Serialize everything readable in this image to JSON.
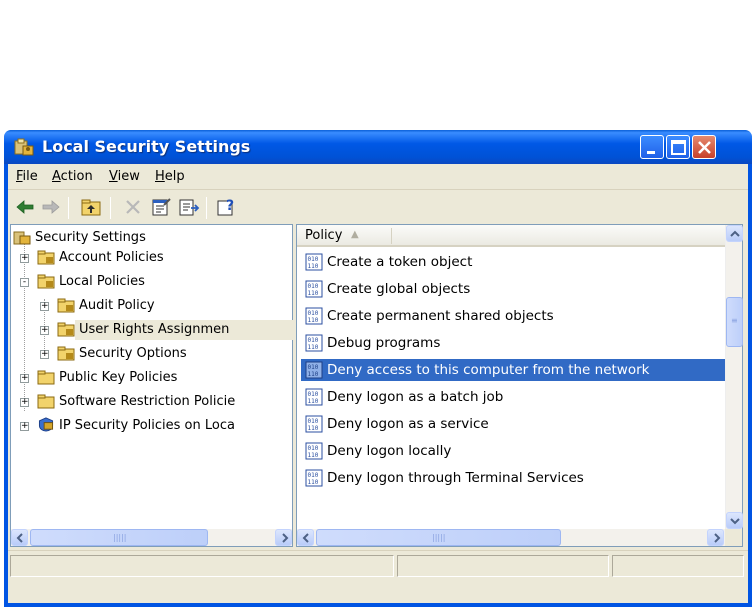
{
  "window": {
    "title": "Local Security Settings",
    "accent": "#0054e3"
  },
  "menu": {
    "items": [
      {
        "label": "File",
        "mnemonic": "F",
        "rest": "ile"
      },
      {
        "label": "Action",
        "mnemonic": "A",
        "rest": "ction"
      },
      {
        "label": "View",
        "mnemonic": "V",
        "rest": "iew"
      },
      {
        "label": "Help",
        "mnemonic": "H",
        "rest": "elp"
      }
    ]
  },
  "toolbar": {
    "icons": [
      "back-arrow-icon",
      "forward-arrow-icon",
      "up-folder-icon",
      "delete-icon",
      "properties-icon",
      "export-list-icon",
      "help-icon"
    ]
  },
  "tree": {
    "root": "Security Settings",
    "items": [
      {
        "label": "Account Policies",
        "level": 1,
        "expander": "+"
      },
      {
        "label": "Local Policies",
        "level": 1,
        "expander": "-"
      },
      {
        "label": "Audit Policy",
        "level": 2,
        "expander": "+"
      },
      {
        "label": "User Rights Assignmen",
        "level": 2,
        "expander": "+",
        "selected": true
      },
      {
        "label": "Security Options",
        "level": 2,
        "expander": "+"
      },
      {
        "label": "Public Key Policies",
        "level": 1,
        "expander": "+"
      },
      {
        "label": "Software Restriction Policie",
        "level": 1,
        "expander": "+"
      },
      {
        "label": "IP Security Policies on Loca",
        "level": 1,
        "expander": "+"
      }
    ]
  },
  "list": {
    "column_header": "Policy",
    "sort_indicator": "▲",
    "rows": [
      {
        "label": "Create a token object",
        "selected": false
      },
      {
        "label": "Create global objects",
        "selected": false
      },
      {
        "label": "Create permanent shared objects",
        "selected": false
      },
      {
        "label": "Debug programs",
        "selected": false
      },
      {
        "label": "Deny access to this computer from the network",
        "selected": true
      },
      {
        "label": "Deny logon as a batch job",
        "selected": false
      },
      {
        "label": "Deny logon as a service",
        "selected": false
      },
      {
        "label": "Deny logon locally",
        "selected": false
      },
      {
        "label": "Deny logon through Terminal Services",
        "selected": false
      }
    ],
    "selection_color": "#316ac5"
  },
  "scroll": {
    "left_h_grip": "|||||",
    "right_h_grip": "|||||",
    "right_v_grip": "≡"
  }
}
